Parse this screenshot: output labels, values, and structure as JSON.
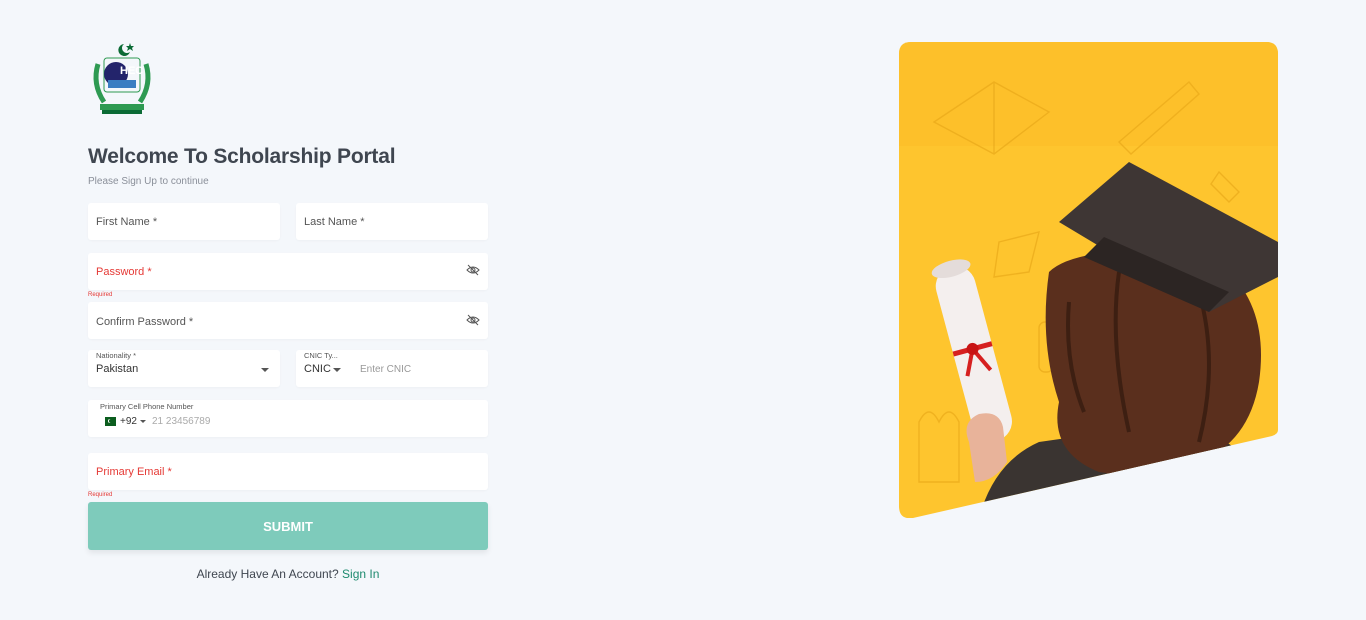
{
  "brand": {
    "logo_text": "HEC"
  },
  "header": {
    "title": "Welcome To Scholarship Portal",
    "subtitle": "Please Sign Up to continue"
  },
  "form": {
    "first_name_placeholder": "First Name *",
    "last_name_placeholder": "Last Name *",
    "password_placeholder": "Password *",
    "password_error": "Required",
    "confirm_password_placeholder": "Confirm Password *",
    "nationality_label": "Nationality *",
    "nationality_value": "Pakistan",
    "cnic_type_label": "CNIC Ty...",
    "cnic_type_value": "CNIC",
    "cnic_placeholder": "Enter CNIC",
    "phone_label": "Primary Cell Phone Number",
    "phone_code": "+92",
    "phone_placeholder": "21 23456789",
    "email_placeholder": "Primary Email *",
    "email_error": "Required",
    "submit_label": "SUBMIT"
  },
  "footer": {
    "account_prompt": "Already Have An Account?",
    "signin_link": "Sign In"
  },
  "colors": {
    "accent": "#7ecbbb",
    "link": "#1d8a6e",
    "error": "#e53935",
    "hero_bg": "#fec52e"
  }
}
